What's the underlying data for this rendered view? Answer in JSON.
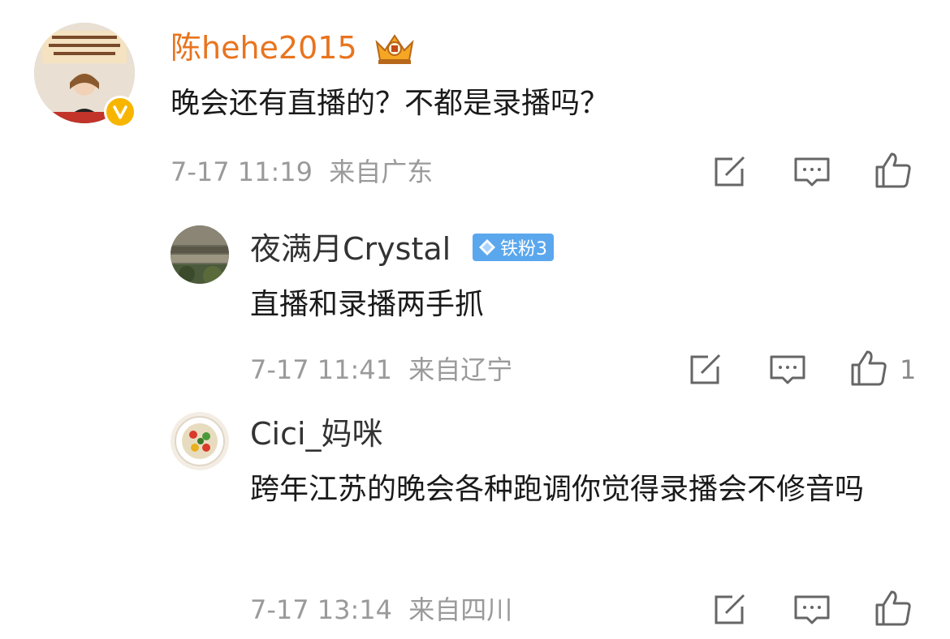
{
  "colors": {
    "accent_name": "#e8741e",
    "sub_name": "#333333",
    "meta": "#9a9a9a",
    "badge_blue": "#5aa7ee",
    "verified": "#f7b500"
  },
  "comments": [
    {
      "username": "陈hehe2015",
      "text": "晚会还有直播的？不都是录播吗？",
      "time": "7-17 11:19",
      "location": "来自广东",
      "icons": [
        "crown-badge-icon",
        "verified-v-icon"
      ]
    },
    {
      "username": "夜满月Crystal",
      "badge": "铁粉3",
      "text": "直播和录播两手抓",
      "time": "7-17 11:41",
      "location": "来自辽宁",
      "like_count": "1"
    },
    {
      "username": "Cici_妈咪",
      "text": "跨年江苏的晚会各种跑调你觉得录播会不修音吗",
      "time": "7-17 13:14",
      "location": "来自四川"
    }
  ]
}
